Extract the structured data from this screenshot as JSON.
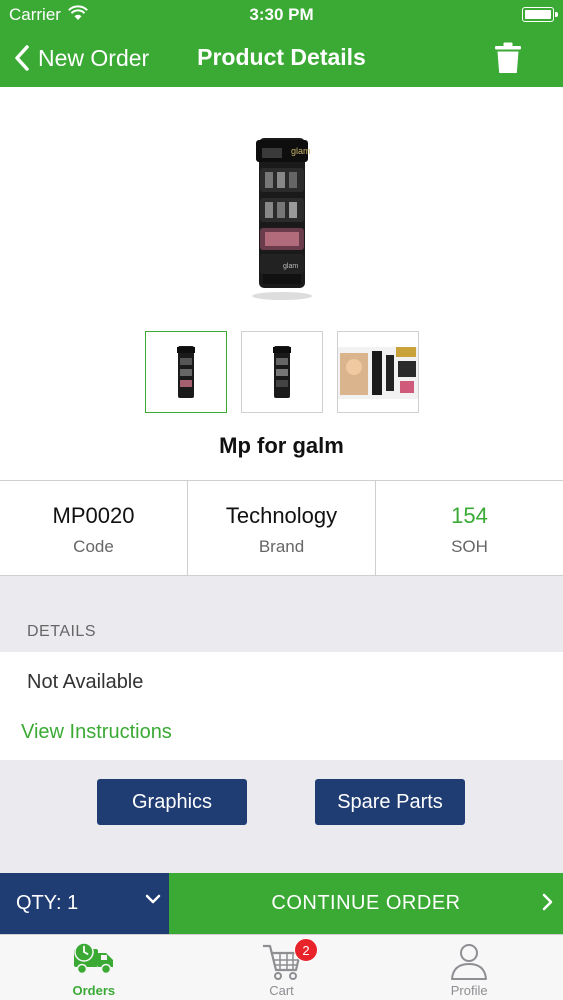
{
  "status_bar": {
    "carrier": "Carrier",
    "time": "3:30 PM"
  },
  "nav": {
    "back_label": "New Order",
    "title": "Product Details"
  },
  "product": {
    "name": "Mp for galm",
    "code_value": "MP0020",
    "code_label": "Code",
    "brand_value": "Technology",
    "brand_label": "Brand",
    "soh_value": "154",
    "soh_label": "SOH"
  },
  "details": {
    "header": "DETAILS",
    "text": "Not Available",
    "link": "View Instructions"
  },
  "buttons": {
    "graphics": "Graphics",
    "spare_parts": "Spare Parts"
  },
  "order_bar": {
    "qty": "QTY: 1",
    "continue": "CONTINUE ORDER"
  },
  "tabs": [
    {
      "label": "Orders",
      "active": true
    },
    {
      "label": "Cart",
      "badge": "2"
    },
    {
      "label": "Profile"
    }
  ],
  "colors": {
    "accent_green": "#3aaa35",
    "navy": "#1f3c73",
    "badge_red": "#e8232a"
  }
}
